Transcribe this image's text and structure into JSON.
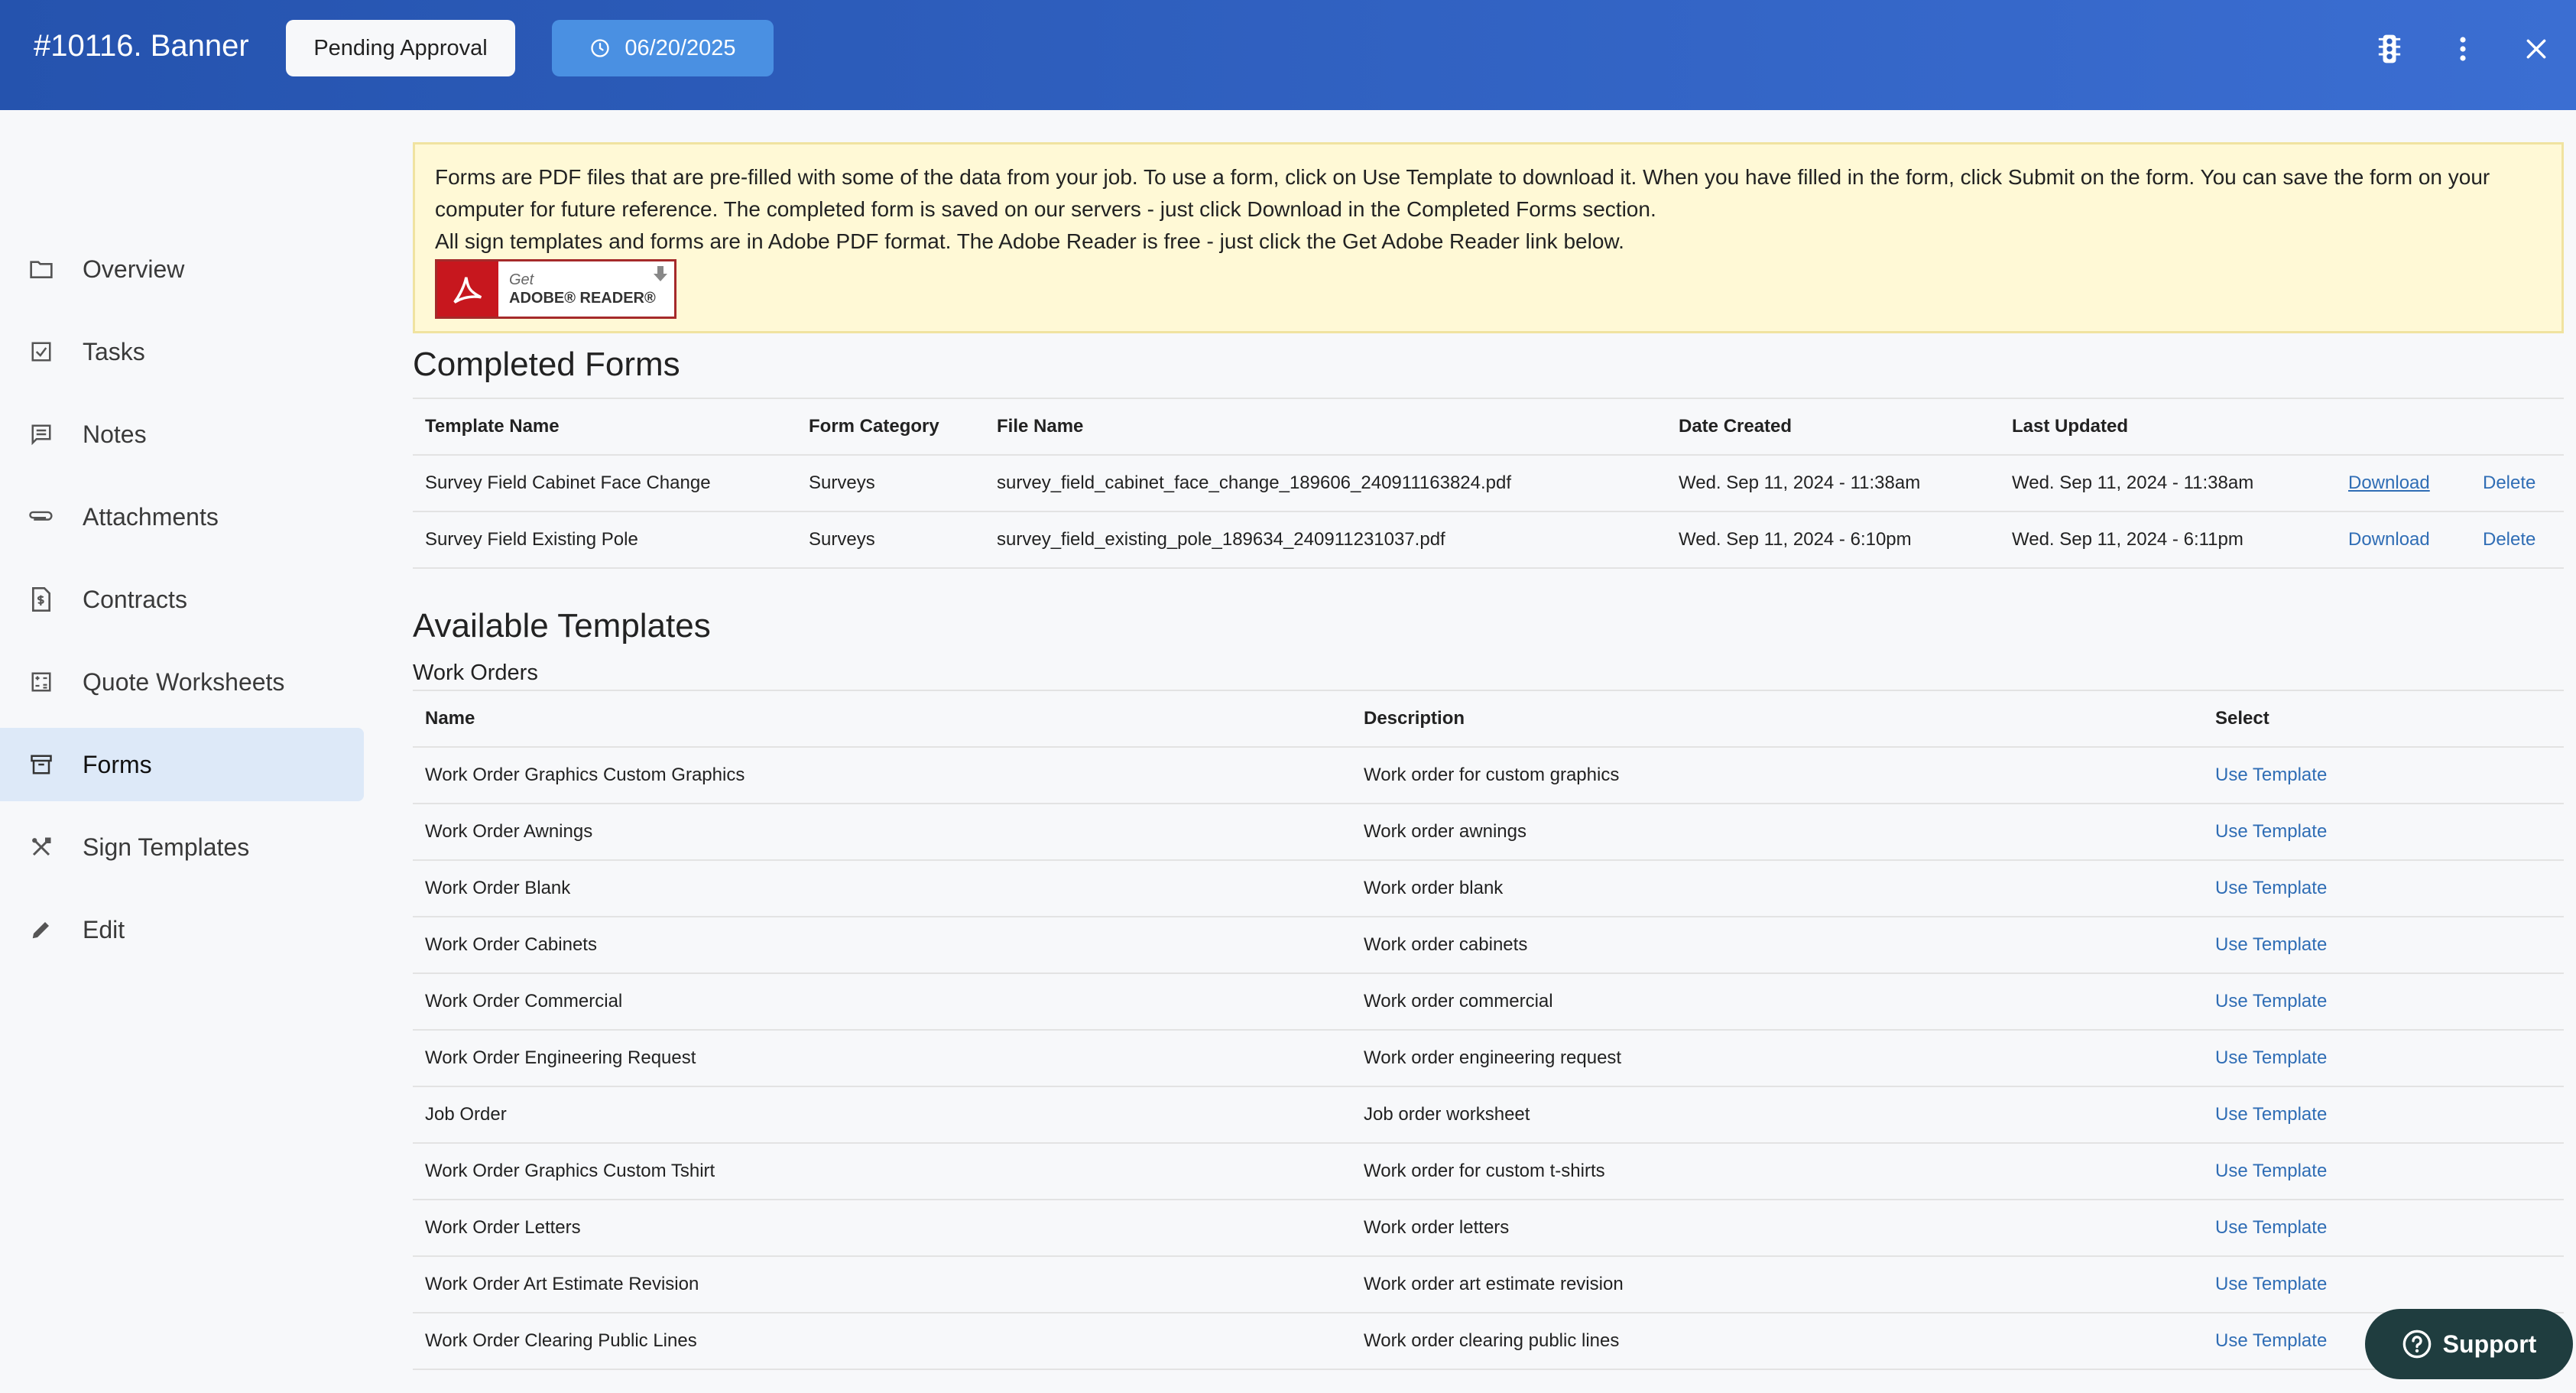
{
  "header": {
    "title": "#10116. Banner",
    "status_label": "Pending Approval",
    "date_label": "06/20/2025"
  },
  "sidebar": {
    "items": [
      {
        "label": "Overview",
        "icon": "folder-icon"
      },
      {
        "label": "Tasks",
        "icon": "checkbox-icon"
      },
      {
        "label": "Notes",
        "icon": "message-icon"
      },
      {
        "label": "Attachments",
        "icon": "paperclip-icon"
      },
      {
        "label": "Contracts",
        "icon": "document-dollar-icon"
      },
      {
        "label": "Quote Worksheets",
        "icon": "calculator-icon"
      },
      {
        "label": "Forms",
        "icon": "archive-icon"
      },
      {
        "label": "Sign Templates",
        "icon": "tools-icon"
      },
      {
        "label": "Edit",
        "icon": "pencil-icon"
      }
    ],
    "active": "Forms"
  },
  "info": {
    "line1": "Forms are PDF files that are pre-filled with some of the data from your job. To use a form, click on Use Template to download it. When you have filled in the form, click Submit on the form. You can save the form on your",
    "line2": "computer for future reference. The completed form is saved on our servers - just click Download in the Completed Forms section.",
    "line3": "All sign templates and forms are in Adobe PDF format. The Adobe Reader is free - just click the Get Adobe Reader link below.",
    "adobe_get": "Get",
    "adobe_name": "ADOBE® READER®"
  },
  "completed": {
    "title": "Completed Forms",
    "headers": [
      "Template Name",
      "Form Category",
      "File Name",
      "Date Created",
      "Last Updated"
    ],
    "rows": [
      {
        "name": "Survey Field Cabinet Face Change",
        "category": "Surveys",
        "file": "survey_field_cabinet_face_change_189606_240911163824.pdf",
        "created": "Wed. Sep 11, 2024 - 11:38am",
        "updated": "Wed. Sep 11, 2024 - 11:38am",
        "download": "Download",
        "delete": "Delete"
      },
      {
        "name": "Survey Field Existing Pole",
        "category": "Surveys",
        "file": "survey_field_existing_pole_189634_240911231037.pdf",
        "created": "Wed. Sep 11, 2024 - 6:10pm",
        "updated": "Wed. Sep 11, 2024 - 6:11pm",
        "download": "Download",
        "delete": "Delete"
      }
    ]
  },
  "available": {
    "title": "Available Templates",
    "group": "Work Orders",
    "headers": [
      "Name",
      "Description",
      "Select"
    ],
    "rows": [
      {
        "name": "Work Order Graphics Custom Graphics",
        "desc": "Work order for custom graphics",
        "action": "Use Template"
      },
      {
        "name": "Work Order Awnings",
        "desc": "Work order awnings",
        "action": "Use Template"
      },
      {
        "name": "Work Order Blank",
        "desc": "Work order blank",
        "action": "Use Template"
      },
      {
        "name": "Work Order Cabinets",
        "desc": "Work order cabinets",
        "action": "Use Template"
      },
      {
        "name": "Work Order Commercial",
        "desc": "Work order commercial",
        "action": "Use Template"
      },
      {
        "name": "Work Order Engineering Request",
        "desc": "Work order engineering request",
        "action": "Use Template"
      },
      {
        "name": "Job Order",
        "desc": "Job order worksheet",
        "action": "Use Template"
      },
      {
        "name": "Work Order Graphics Custom Tshirt",
        "desc": "Work order for custom t-shirts",
        "action": "Use Template"
      },
      {
        "name": "Work Order Letters",
        "desc": "Work order letters",
        "action": "Use Template"
      },
      {
        "name": "Work Order Art Estimate Revision",
        "desc": "Work order art estimate revision",
        "action": "Use Template"
      },
      {
        "name": "Work Order Clearing Public Lines",
        "desc": "Work order clearing public lines",
        "action": "Use Template"
      }
    ]
  },
  "support_label": "Support",
  "colors": {
    "header_start": "#2553ae",
    "header_end": "#3b6ed2",
    "date_button": "#4a90e2",
    "link": "#2f6db5",
    "active_nav": "#dde9f8",
    "support": "#1f3d3f"
  }
}
